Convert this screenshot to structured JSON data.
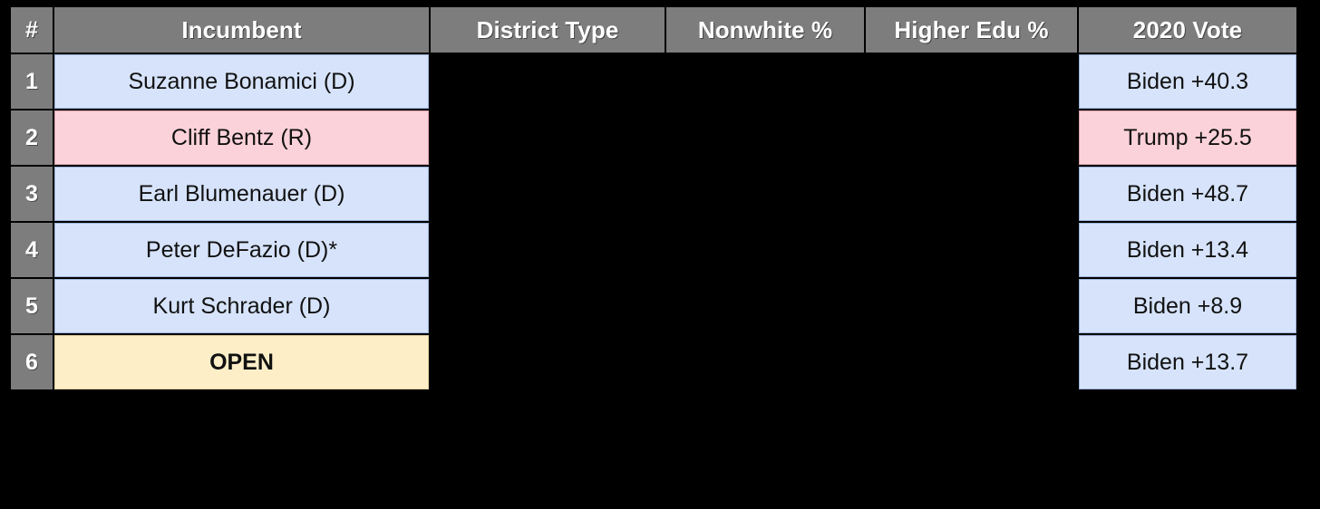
{
  "table": {
    "columns": [
      {
        "key": "num",
        "label": "#"
      },
      {
        "key": "inc",
        "label": "Incumbent"
      },
      {
        "key": "dtype",
        "label": "District Type"
      },
      {
        "key": "nw",
        "label": "Nonwhite %"
      },
      {
        "key": "edu",
        "label": "Higher Edu %"
      },
      {
        "key": "vote",
        "label": "2020 Vote"
      }
    ],
    "rows": [
      {
        "num": "1",
        "incumbent": "Suzanne Bonamici (D)",
        "incumbent_fill": "blue",
        "district_type": "",
        "nonwhite_pct": "",
        "higher_edu_pct": "",
        "vote_2020": "Biden +40.3",
        "vote_fill": "blue",
        "bold": false
      },
      {
        "num": "2",
        "incumbent": "Cliff Bentz (R)",
        "incumbent_fill": "pink",
        "district_type": "",
        "nonwhite_pct": "",
        "higher_edu_pct": "",
        "vote_2020": "Trump +25.5",
        "vote_fill": "pink",
        "bold": false
      },
      {
        "num": "3",
        "incumbent": "Earl Blumenauer (D)",
        "incumbent_fill": "blue",
        "district_type": "",
        "nonwhite_pct": "",
        "higher_edu_pct": "",
        "vote_2020": "Biden +48.7",
        "vote_fill": "blue",
        "bold": false
      },
      {
        "num": "4",
        "incumbent": "Peter DeFazio (D)*",
        "incumbent_fill": "blue",
        "district_type": "",
        "nonwhite_pct": "",
        "higher_edu_pct": "",
        "vote_2020": "Biden +13.4",
        "vote_fill": "blue",
        "bold": false
      },
      {
        "num": "5",
        "incumbent": "Kurt Schrader (D)",
        "incumbent_fill": "blue",
        "district_type": "",
        "nonwhite_pct": "",
        "higher_edu_pct": "",
        "vote_2020": "Biden +8.9",
        "vote_fill": "blue",
        "bold": false
      },
      {
        "num": "6",
        "incumbent": "OPEN",
        "incumbent_fill": "cream",
        "district_type": "",
        "nonwhite_pct": "",
        "higher_edu_pct": "",
        "vote_2020": "Biden +13.7",
        "vote_fill": "blue",
        "bold": true
      }
    ]
  },
  "colors": {
    "background": "#000000",
    "header_gray": "#7d7d7d",
    "democrat_blue": "#d6e3fb",
    "republican_pink": "#fcd2da",
    "open_cream": "#fdeec8",
    "header_text": "#ffffff",
    "cell_text": "#111111"
  }
}
